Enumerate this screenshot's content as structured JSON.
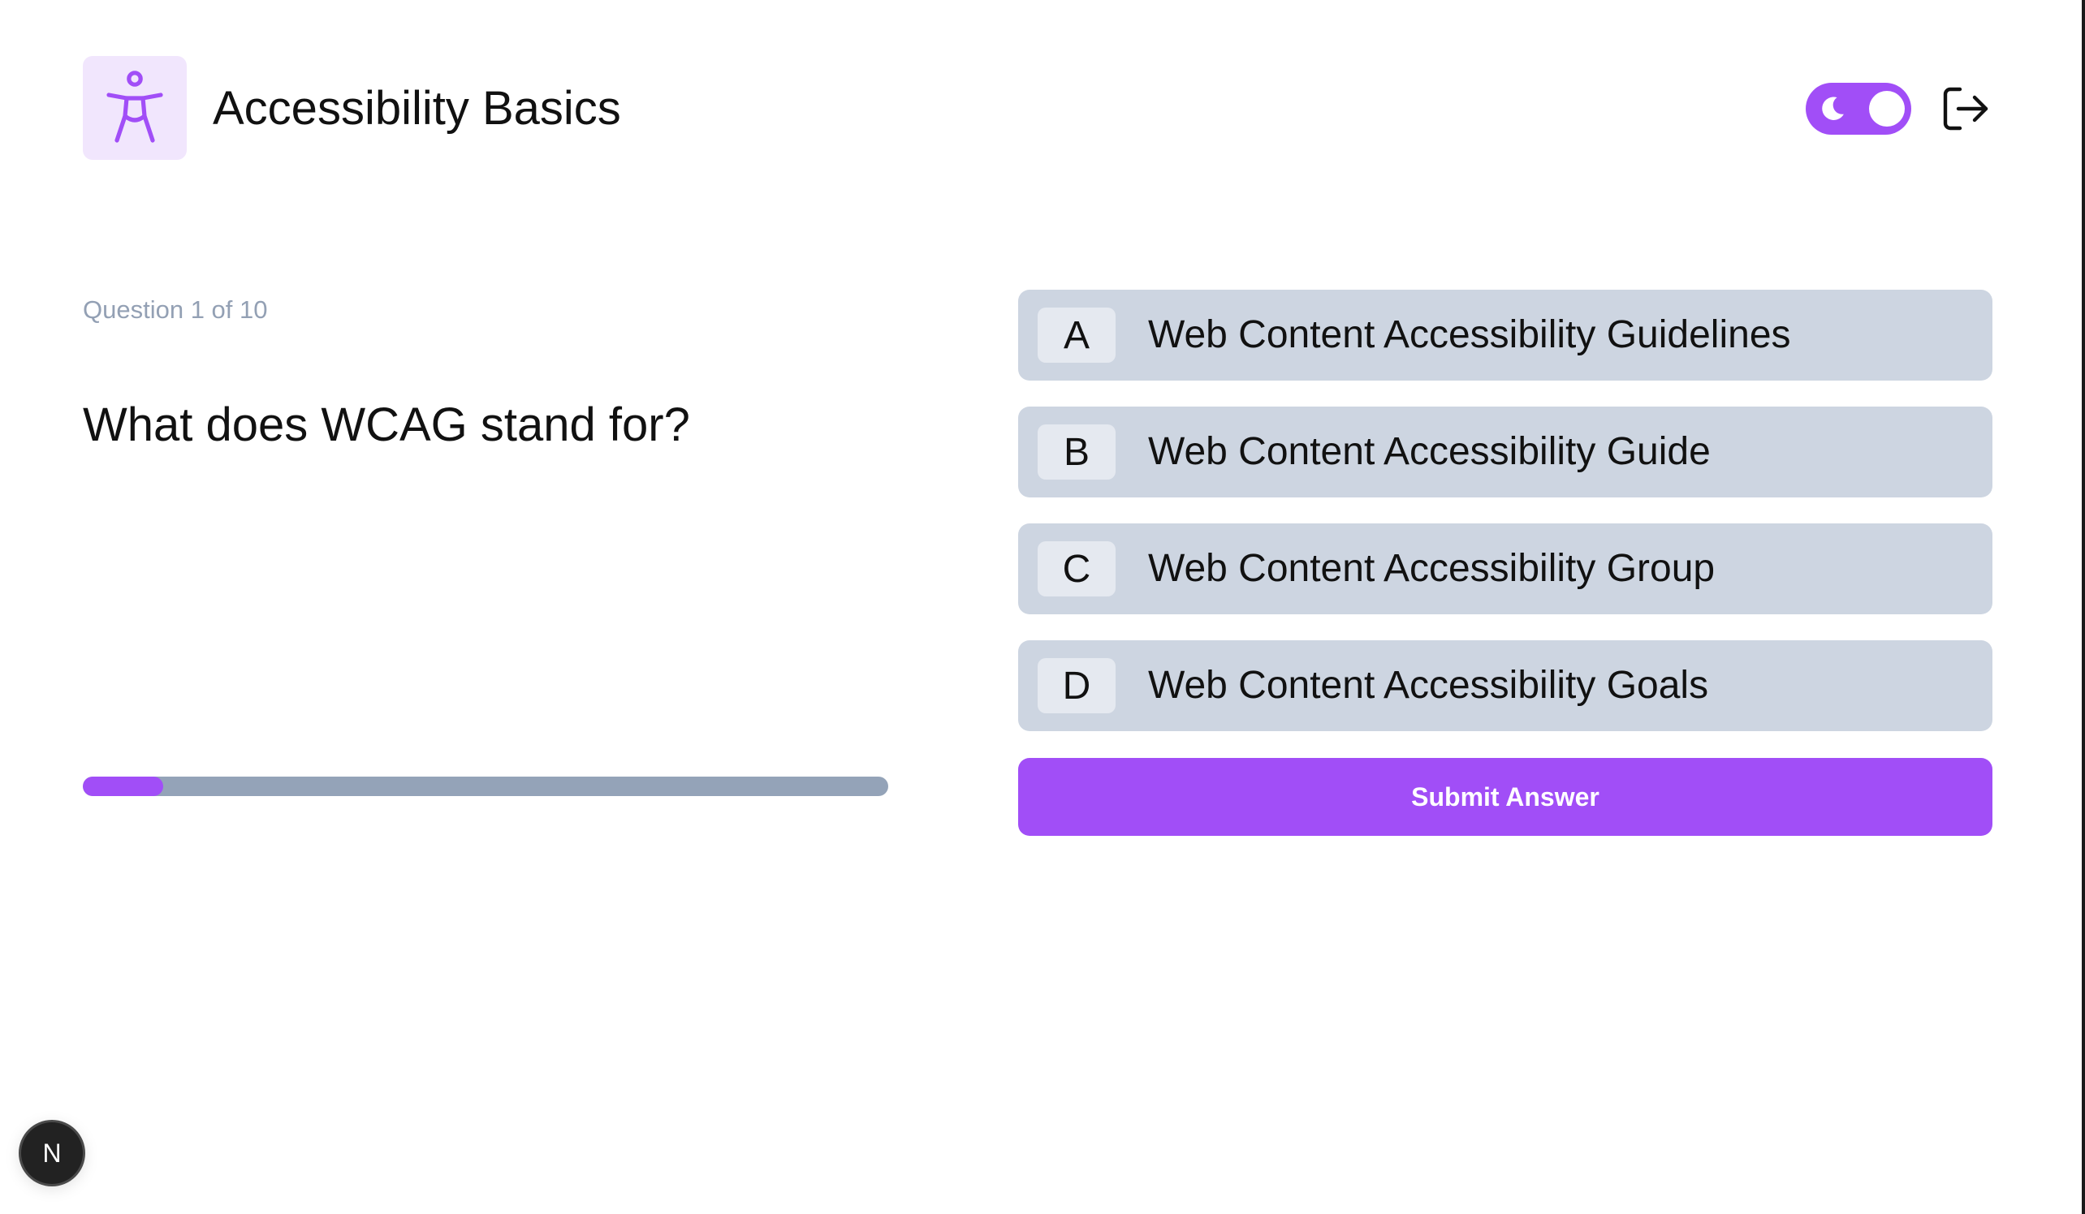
{
  "header": {
    "app_icon": "accessibility-person-icon",
    "title": "Accessibility Basics",
    "theme_toggle": {
      "icon": "moon-icon",
      "state": "dark-mode-on"
    },
    "logout_icon": "logout-icon"
  },
  "question": {
    "counter": "Question 1 of 10",
    "text": "What does WCAG stand for?",
    "progress_fraction": 0.1
  },
  "answers": [
    {
      "letter": "A",
      "text": "Web Content Accessibility Guidelines"
    },
    {
      "letter": "B",
      "text": "Web Content Accessibility Guide"
    },
    {
      "letter": "C",
      "text": "Web Content Accessibility Group"
    },
    {
      "letter": "D",
      "text": "Web Content Accessibility Goals"
    }
  ],
  "submit_label": "Submit Answer",
  "dev_badge": {
    "letter": "N"
  },
  "colors": {
    "accent": "#a14ef7",
    "icon_bg": "#f1e6fd",
    "answer_bg": "#cdd5e1",
    "letter_bg": "#e5e9f0",
    "progress_track": "#94a3b8",
    "muted_text": "#93a0b4"
  }
}
